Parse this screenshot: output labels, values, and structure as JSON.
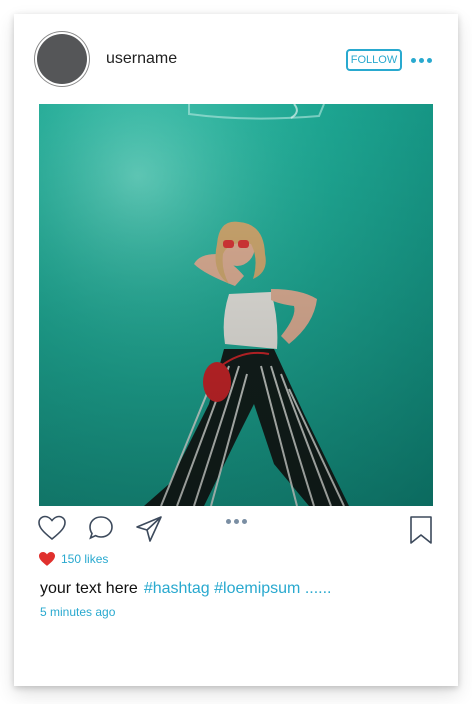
{
  "post": {
    "username": "username",
    "follow_label": "FOLLOW",
    "likes": "150 likes",
    "caption_text": "your text here",
    "hashtags": "#hashtag #loemipsum ......",
    "time_ago": "5 minutes ago"
  },
  "icons": {
    "more": "more-dots-icon",
    "like": "heart-outline-icon",
    "comment": "comment-bubble-icon",
    "share": "paper-plane-icon",
    "carousel": "carousel-dots-icon",
    "save": "bookmark-icon",
    "likes_heart": "heart-filled-icon"
  },
  "colors": {
    "accent": "#29a9cf",
    "like_red": "#e0302d",
    "photo_teal": "#1fae99",
    "avatar_gray": "#555658"
  }
}
